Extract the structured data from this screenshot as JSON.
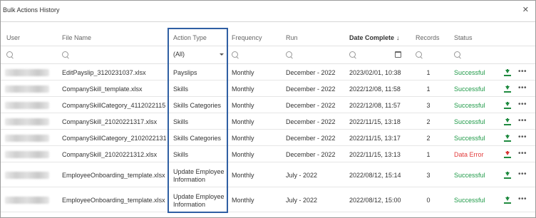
{
  "window": {
    "title": "Bulk Actions History",
    "close_glyph": "✕"
  },
  "columns": {
    "user": "User",
    "file_name": "File Name",
    "action_type": "Action Type",
    "frequency": "Frequency",
    "run": "Run",
    "date_complete": "Date Complete",
    "date_sort_glyph": "↓",
    "records": "Records",
    "status": "Status"
  },
  "filters": {
    "action_type_selected": "(All)"
  },
  "colors": {
    "success": "#1f9a48",
    "error": "#e23b3b",
    "highlight": "#2f5fa3"
  },
  "rows": [
    {
      "file": "EditPayslip_3120231037.xlsx",
      "action": "Payslips",
      "frequency": "Monthly",
      "run": "December - 2022",
      "date": "2023/02/01, 10:38",
      "records": "1",
      "status": "Successful"
    },
    {
      "file": "CompanySkill_template.xlsx",
      "action": "Skills",
      "frequency": "Monthly",
      "run": "December - 2022",
      "date": "2022/12/08, 11:58",
      "records": "1",
      "status": "Successful"
    },
    {
      "file": "CompanySkillCategory_4112022115...",
      "action": "Skills Categories",
      "frequency": "Monthly",
      "run": "December - 2022",
      "date": "2022/12/08, 11:57",
      "records": "3",
      "status": "Successful"
    },
    {
      "file": "CompanySkill_21020221317.xlsx",
      "action": "Skills",
      "frequency": "Monthly",
      "run": "December - 2022",
      "date": "2022/11/15, 13:18",
      "records": "2",
      "status": "Successful"
    },
    {
      "file": "CompanySkillCategory_2102022131...",
      "action": "Skills Categories",
      "frequency": "Monthly",
      "run": "December - 2022",
      "date": "2022/11/15, 13:17",
      "records": "2",
      "status": "Successful"
    },
    {
      "file": "CompanySkill_21020221312.xlsx",
      "action": "Skills",
      "frequency": "Monthly",
      "run": "December - 2022",
      "date": "2022/11/15, 13:13",
      "records": "1",
      "status": "Data Error"
    },
    {
      "file": "EmployeeOnboarding_template.xlsx",
      "action": "Update Employee Information",
      "frequency": "Monthly",
      "run": "July - 2022",
      "date": "2022/08/12, 15:14",
      "records": "3",
      "status": "Successful"
    },
    {
      "file": "EmployeeOnboarding_template.xlsx",
      "action": "Update Employee Information",
      "frequency": "Monthly",
      "run": "July - 2022",
      "date": "2022/08/12, 15:00",
      "records": "0",
      "status": "Successful"
    }
  ],
  "icons": {
    "download": "download-icon",
    "more": "more-icon",
    "search": "search-icon",
    "calendar": "calendar-icon"
  }
}
